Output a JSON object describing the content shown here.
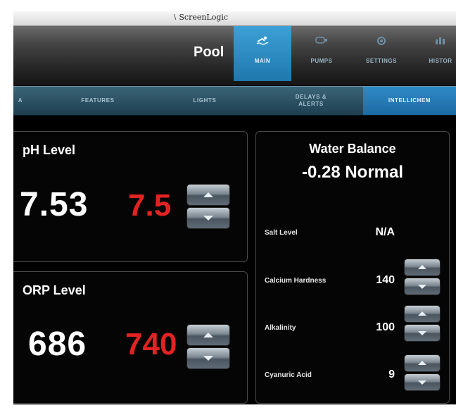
{
  "window": {
    "title": "ScreenLogic"
  },
  "header": {
    "title": "Pool"
  },
  "top_nav": [
    {
      "label": "MAIN",
      "icon": "swimmer-icon",
      "active": true
    },
    {
      "label": "PUMPS",
      "icon": "pump-icon"
    },
    {
      "label": "SETTINGS",
      "icon": "gear-icon"
    },
    {
      "label": "HISTOR",
      "icon": "history-chart-icon"
    }
  ],
  "sub_nav": [
    {
      "label": "A"
    },
    {
      "label": "FEATURES"
    },
    {
      "label": "LIGHTS"
    },
    {
      "label": "DELAYS &",
      "label2": "ALERTS"
    },
    {
      "label": "INTELLICHEM",
      "active": true
    }
  ],
  "ph": {
    "title": "pH Level",
    "current": "7.53",
    "setpoint": "7.5"
  },
  "orp": {
    "title": "ORP Level",
    "current": "686",
    "setpoint": "740"
  },
  "water_balance": {
    "title": "Water Balance",
    "value": "-0.28 Normal",
    "rows": [
      {
        "label": "Salt Level",
        "value": "N/A"
      },
      {
        "label": "Calcium Hardness",
        "value": "140"
      },
      {
        "label": "Alkalinity",
        "value": "100"
      },
      {
        "label": "Cyanuric Acid",
        "value": "9"
      }
    ]
  },
  "colors": {
    "accent": "#2a8fd0",
    "setpoint_red": "#e32222",
    "background": "#000000"
  }
}
